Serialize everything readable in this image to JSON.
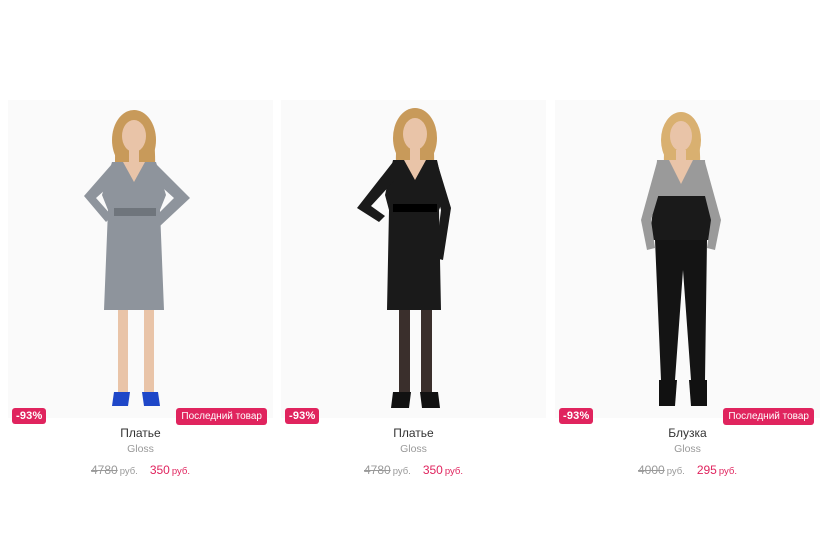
{
  "products": [
    {
      "discount": "-93%",
      "last_item": "Последний товар",
      "name": "Платье",
      "brand": "Gloss",
      "old_price": "4780",
      "new_price": "350",
      "currency": "руб.",
      "garment": "grey-dress"
    },
    {
      "discount": "-93%",
      "last_item": "",
      "name": "Платье",
      "brand": "Gloss",
      "old_price": "4780",
      "new_price": "350",
      "currency": "руб.",
      "garment": "black-dress"
    },
    {
      "discount": "-93%",
      "last_item": "Последний товар",
      "name": "Блузка",
      "brand": "Gloss",
      "old_price": "4000",
      "new_price": "295",
      "currency": "руб.",
      "garment": "blouse-and-trousers"
    }
  ],
  "colors": {
    "accent": "#e0245e",
    "muted": "#999999",
    "grey_dress": "#8e949c",
    "black": "#1a1a1a",
    "hair": "#c89a5a",
    "skin": "#e9c4a8"
  }
}
